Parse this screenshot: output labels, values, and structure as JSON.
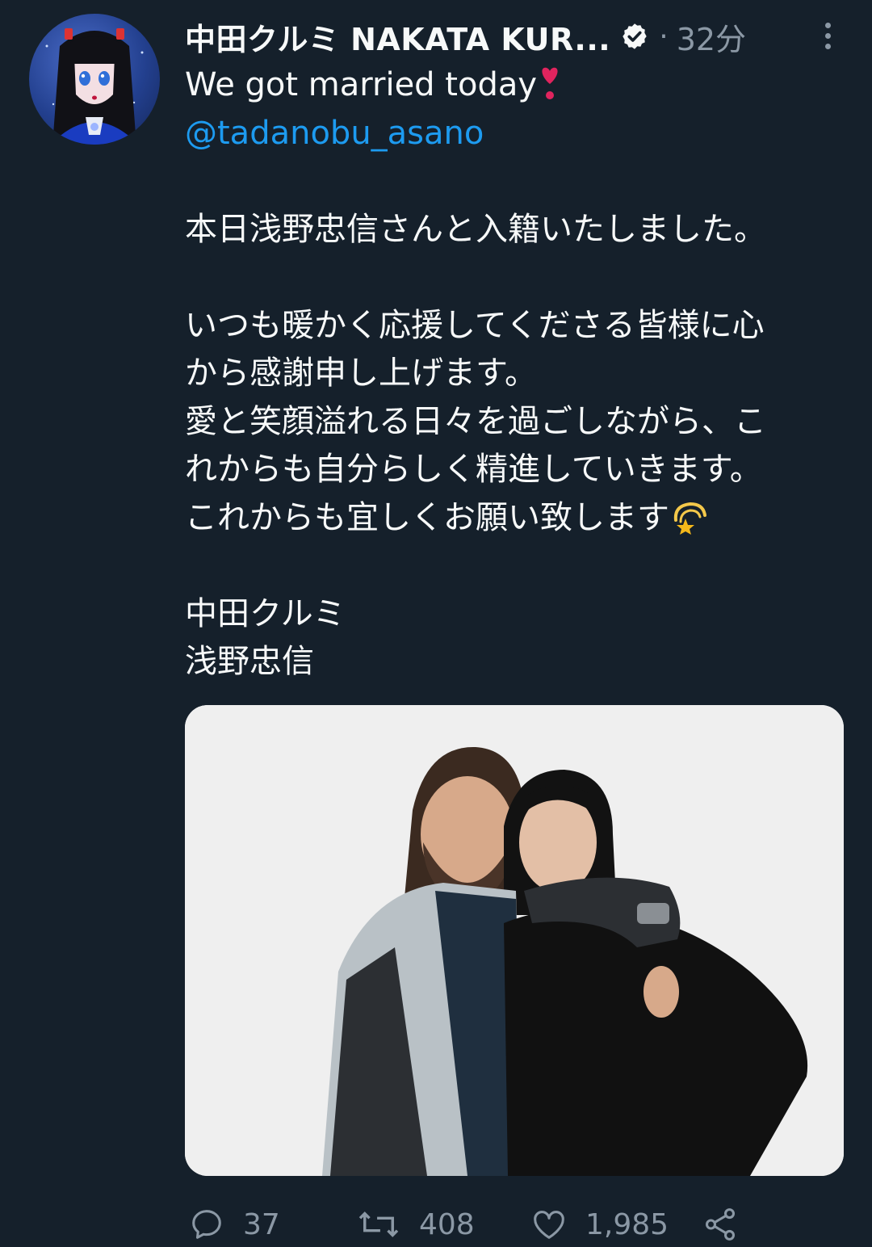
{
  "tweet": {
    "display_name": "中田クルミ NAKATA KUR...",
    "separator": "·",
    "time": "32分",
    "lines": [
      "We got married today",
      "@tadanobu_asano",
      "",
      "本日浅野忠信さんと入籍いたしました。",
      "",
      "いつも暖かく応援してくださる皆様に心",
      "から感謝申し上げます。",
      "愛と笑顔溢れる日々を過ごしながら、こ",
      "れからも自分らしく精進していきます。",
      "これからも宜しくお願い致します",
      "",
      "中田クルミ",
      "浅野忠信"
    ]
  },
  "icons": {
    "verified": "verified-badge-icon",
    "more": "more-options-icon",
    "heart_emoji": "red-exclamation-heart-emoji",
    "dizzy_emoji": "dizzy-star-emoji",
    "reply": "reply-icon",
    "retweet": "retweet-icon",
    "like": "like-icon",
    "share": "share-icon"
  },
  "actions": {
    "replies": "37",
    "retweets": "408",
    "likes": "1,985"
  },
  "colors": {
    "background": "#15202b",
    "text": "#f7f9f9",
    "secondary": "#8b98a5",
    "link": "#1d9bf0"
  }
}
